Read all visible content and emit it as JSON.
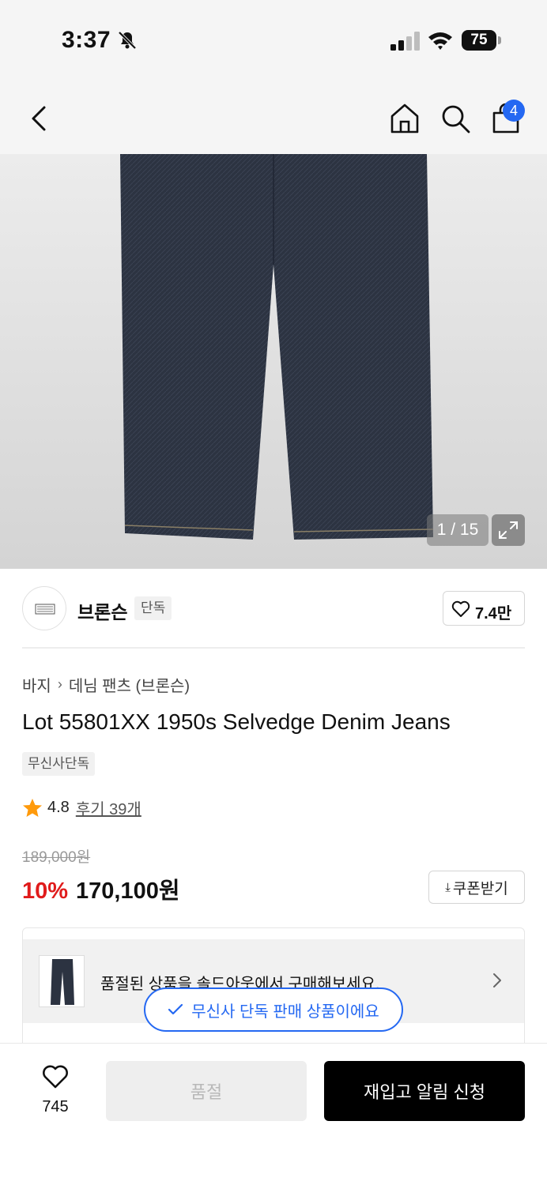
{
  "status_bar": {
    "time": "3:37",
    "battery": "75",
    "icons": [
      "bell-slash-icon",
      "signal-icon",
      "wifi-icon",
      "battery-icon"
    ]
  },
  "nav": {
    "cart_count": "4",
    "icons": [
      "back-icon",
      "home-icon",
      "search-icon",
      "shopping-bag-icon"
    ]
  },
  "image": {
    "counter": "1 / 15",
    "icons": [
      "expand-icon"
    ]
  },
  "brand": {
    "name": "브론슨",
    "tag": "단독",
    "likes": "7.4만"
  },
  "product": {
    "breadcrumb": [
      "바지",
      "데님 팬츠 (브론슨)"
    ],
    "title": "Lot 55801XX 1950s Selvedge Denim Jeans",
    "badge": "무신사단독",
    "rating": "4.8",
    "reviews": "후기 39개",
    "original_price": "189,000원",
    "discount": "10%",
    "sale_price": "170,100원",
    "coupon_label": "쿠폰받기"
  },
  "soldout_banner": {
    "text": "품절된 상품을 솔드아웃에서 구매해보세요."
  },
  "toast": {
    "text": "무신사 단독 판매 상품이에요"
  },
  "bottom": {
    "wish_count": "745",
    "soldout_label": "품절",
    "restock_label": "재입고 알림 신청"
  },
  "colors": {
    "accent_blue": "#2468f2",
    "discount_red": "#e01b1b",
    "star_orange": "#ff9a0b"
  }
}
